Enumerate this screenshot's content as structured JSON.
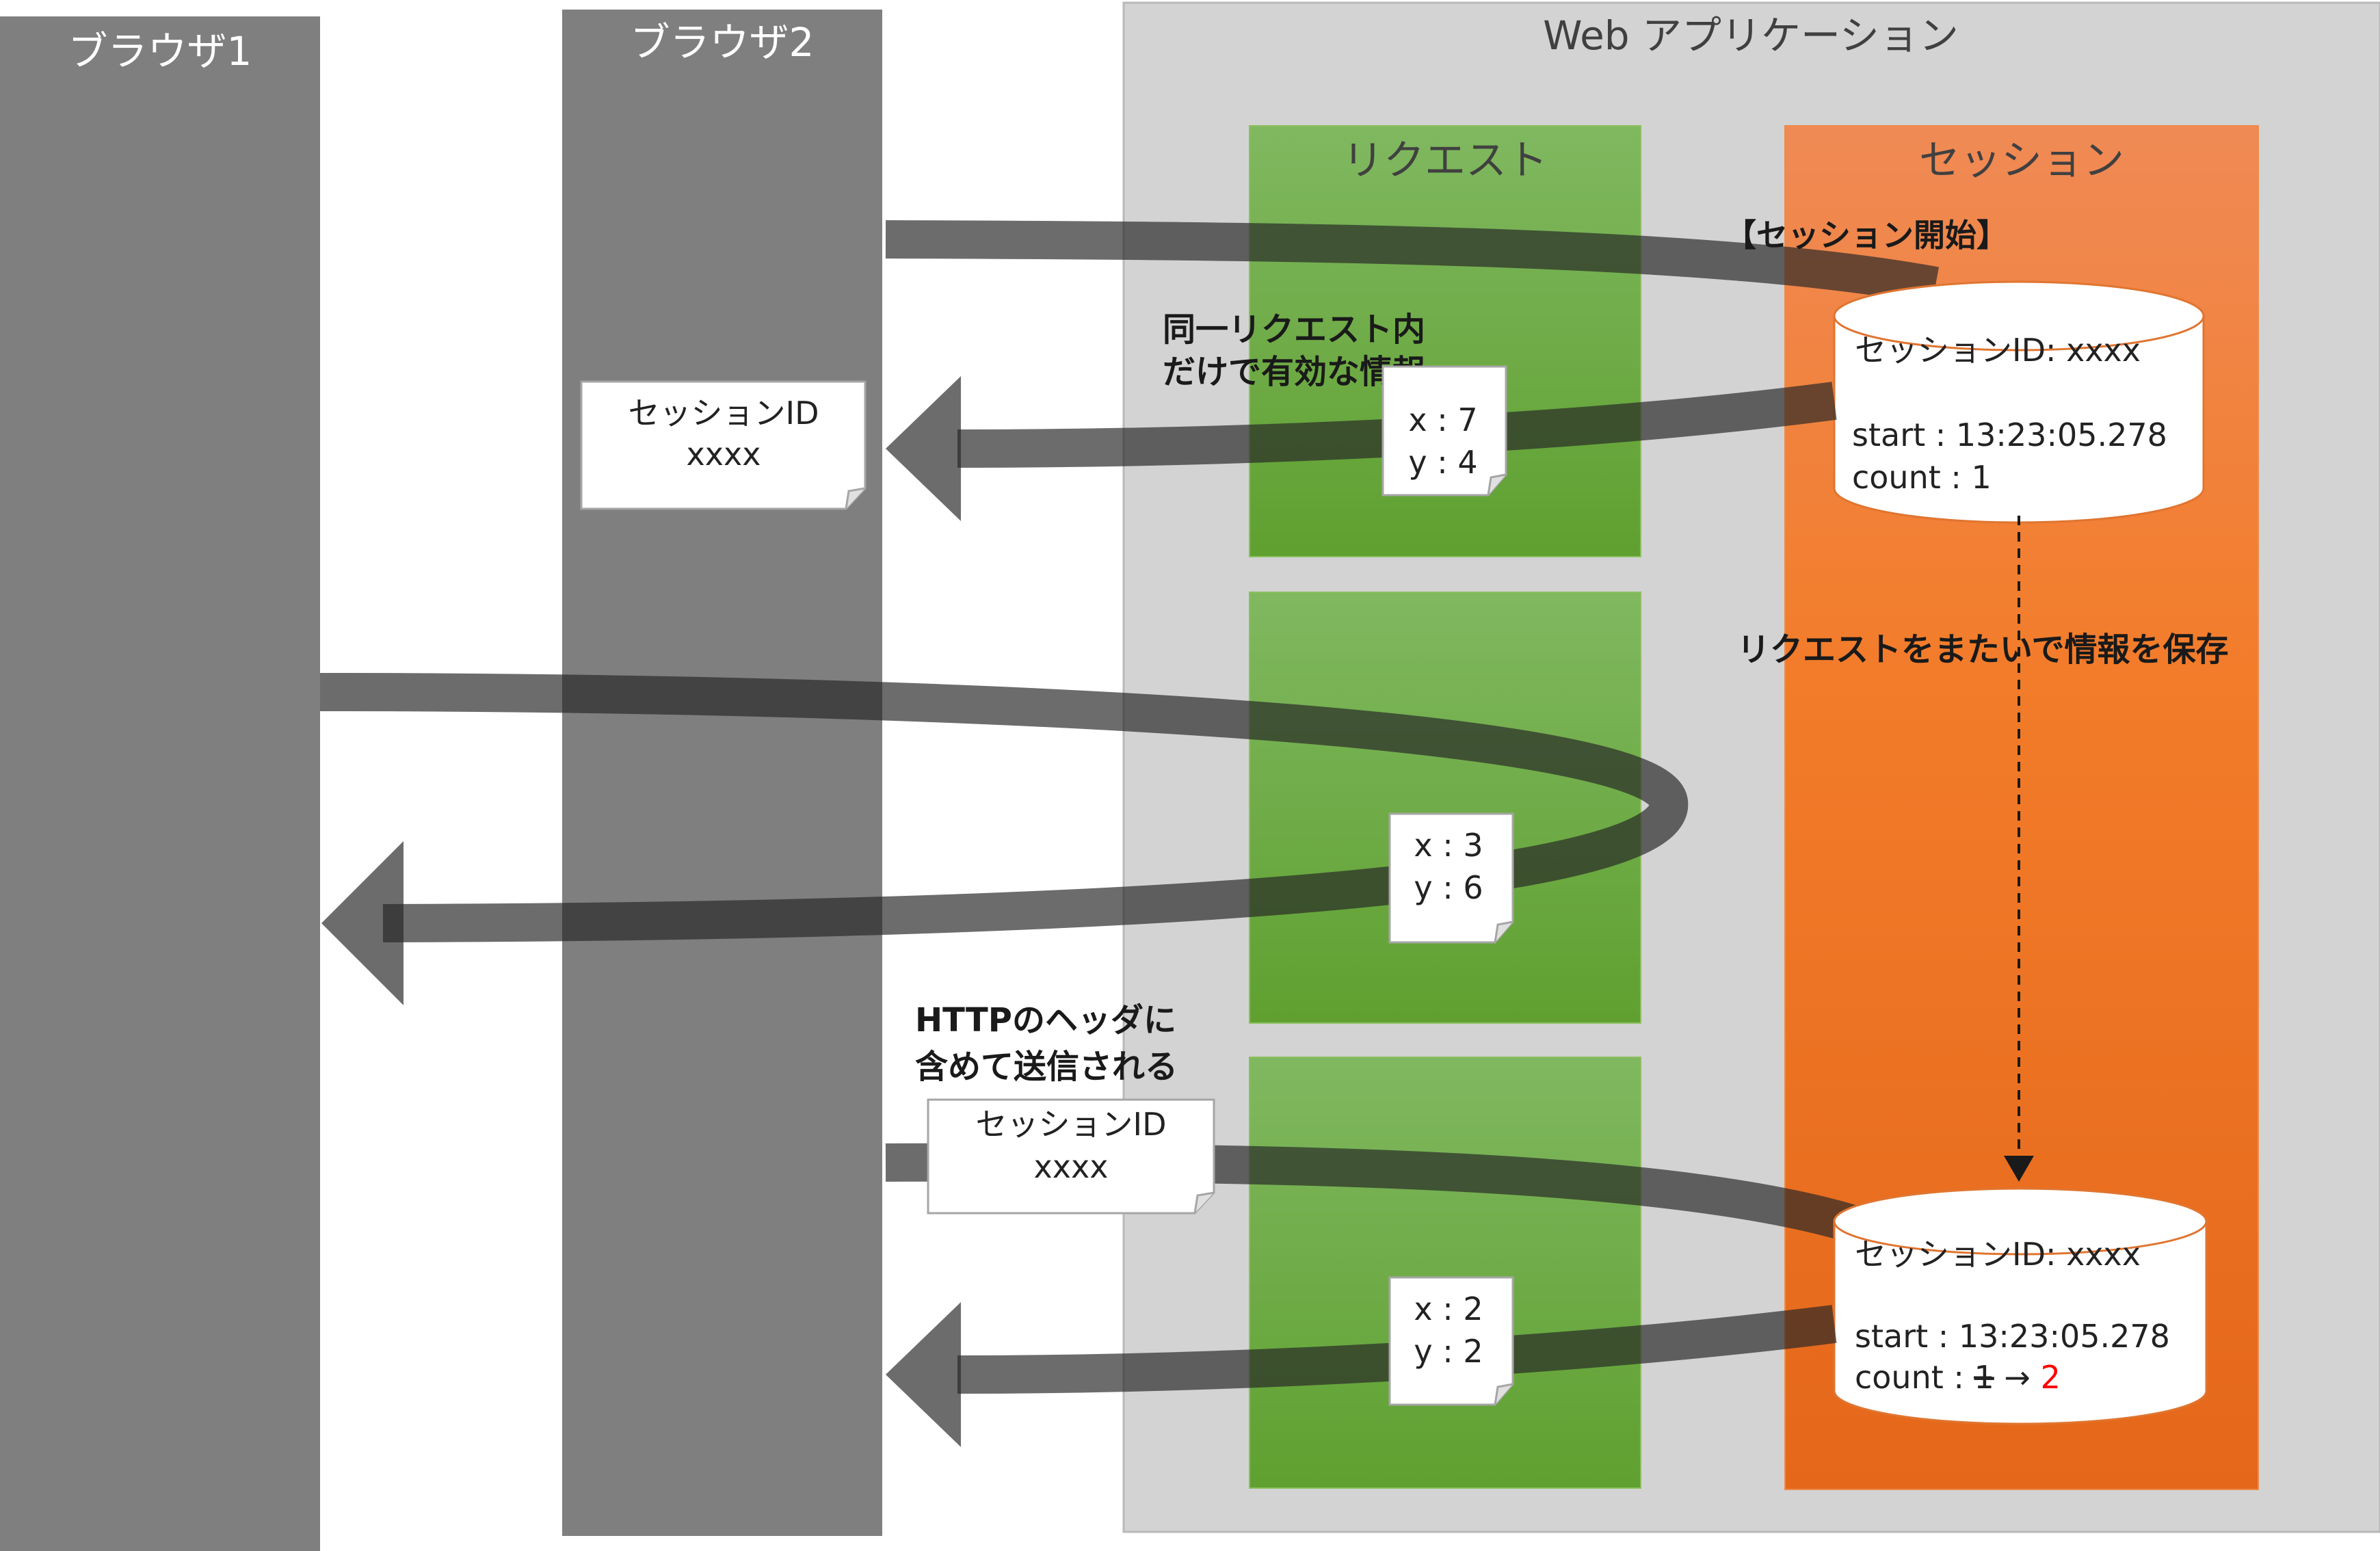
{
  "lanes": {
    "browser1": "ブラウザ1",
    "browser2": "ブラウザ2",
    "webapp": "Web アプリケーション",
    "request": "リクエスト",
    "session": "セッション"
  },
  "annotations": {
    "session_start": "【セッション開始】",
    "request_scope_line1": "同一リクエスト内",
    "request_scope_line2": "だけで有効な情報",
    "across_requests": "リクエストをまたいで情報を保存",
    "http_header_line1": "HTTPのヘッダに",
    "http_header_line2": "含めて送信される"
  },
  "notes": {
    "sid_response": {
      "line1": "セッションID",
      "line2": "xxxx"
    },
    "sid_request": {
      "line1": "セッションID",
      "line2": "xxxx"
    },
    "req1": {
      "x": "x : 7",
      "y": "y : 4"
    },
    "req2": {
      "x": "x : 3",
      "y": "y : 6"
    },
    "req3": {
      "x": "x : 2",
      "y": "y : 2"
    }
  },
  "stores": {
    "first": {
      "id": "セッションID: xxxx",
      "start": "start : 13:23:05.278",
      "count": "count : 1"
    },
    "second": {
      "id": "セッションID: xxxx",
      "start": "start : 13:23:05.278",
      "count_prefix": "count : ",
      "count_old": "1",
      "count_arrow": " → ",
      "count_new": "2"
    }
  },
  "colors": {
    "browser_lane": "#7f7f7f",
    "webapp_bg": "#d3d3d3",
    "request_green": "#6aad3d",
    "session_orange": "#f08030",
    "flow_band": "#262626",
    "highlight_red": "#ff0000"
  }
}
